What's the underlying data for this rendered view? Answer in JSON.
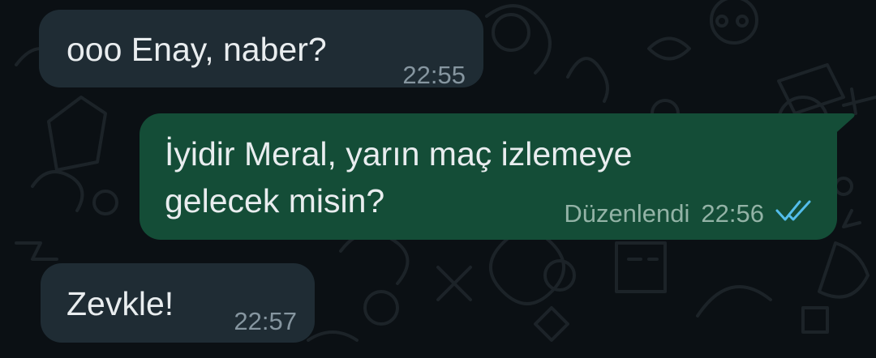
{
  "messages": [
    {
      "direction": "incoming",
      "text": "ooo Enay, naber?",
      "time": "22:55"
    },
    {
      "direction": "outgoing",
      "text_line1": "İyidir Meral, yarın maç izlemeye",
      "text_line2": "gelecek misin?",
      "edited_label": "Düzenlendi",
      "time": "22:56",
      "status_icon": "double-check-read-icon"
    },
    {
      "direction": "incoming",
      "text": "Zevkle!",
      "time": "22:57"
    }
  ],
  "colors": {
    "background": "#0b1014",
    "incoming_bubble": "#1f2c34",
    "outgoing_bubble": "#144d37",
    "read_tick": "#53bdeb"
  }
}
